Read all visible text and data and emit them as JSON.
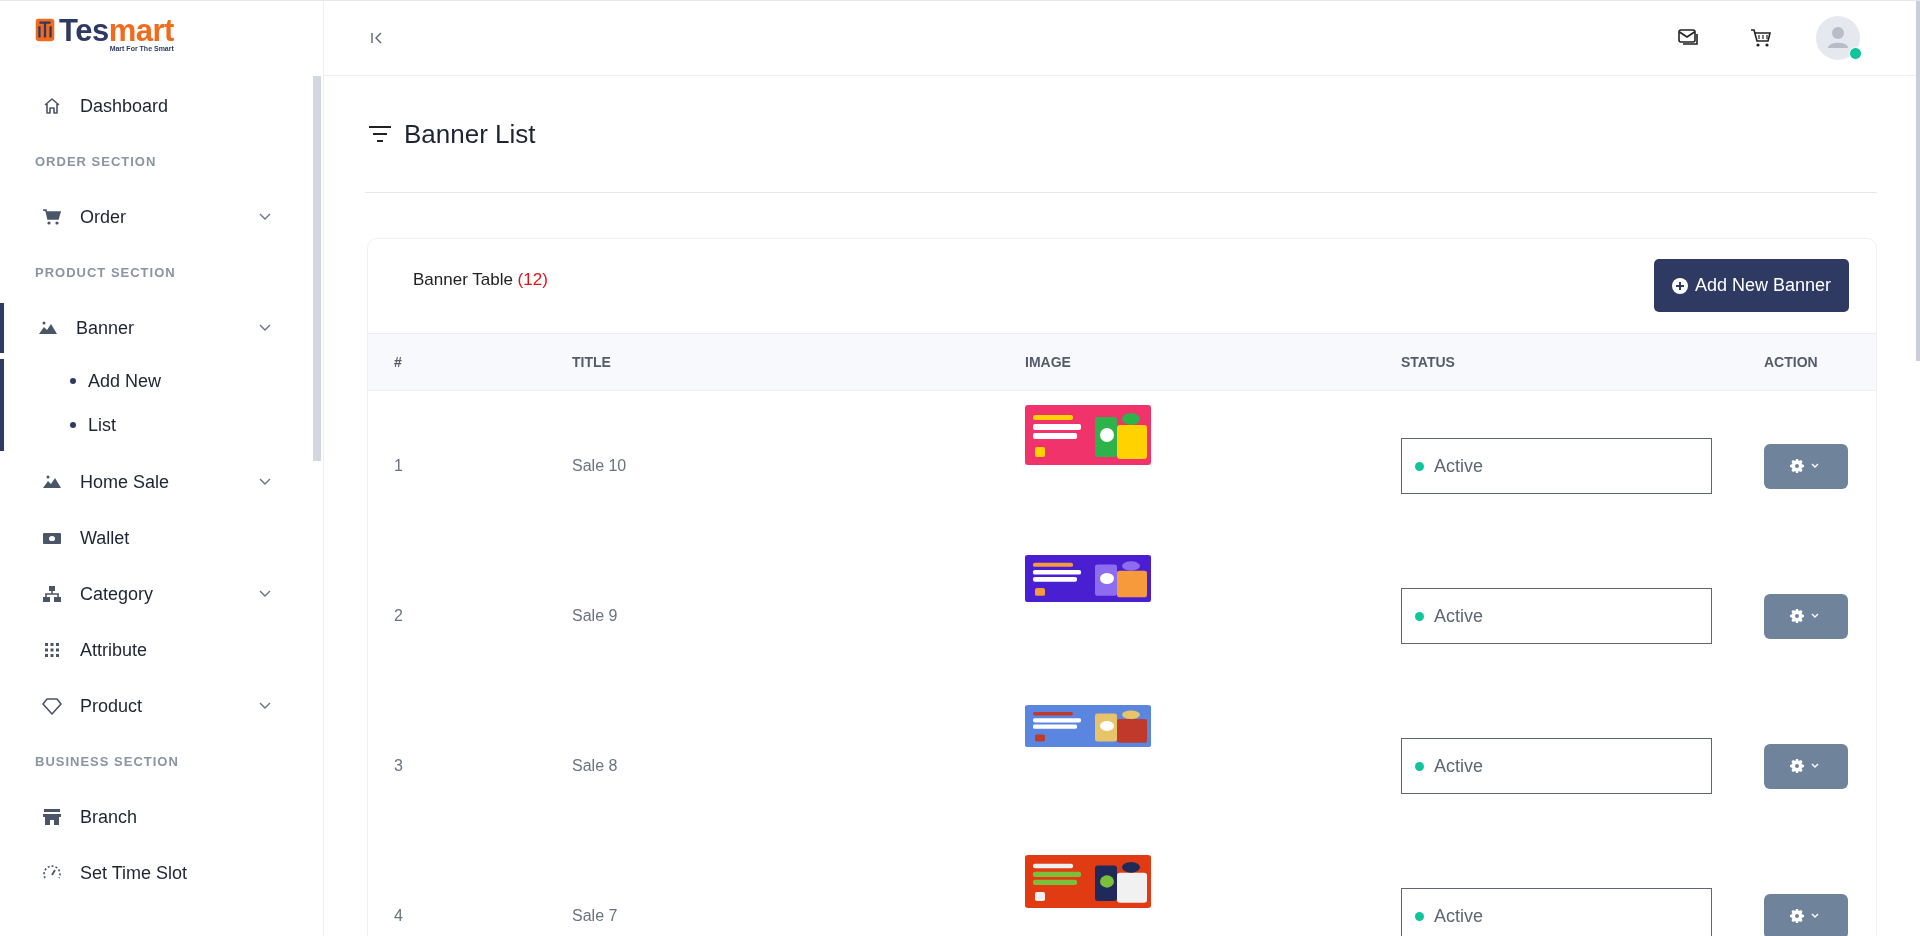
{
  "brand": {
    "name_dark": "Tes",
    "name_accent": "mart",
    "tagline": "Mart For The Smart"
  },
  "sidebar": {
    "items": [
      {
        "kind": "item",
        "label": "Dashboard",
        "selected": false
      },
      {
        "kind": "heading",
        "label": "ORDER SECTION"
      },
      {
        "kind": "group",
        "label": "Order",
        "selected": false
      },
      {
        "kind": "heading",
        "label": "PRODUCT SECTION"
      },
      {
        "kind": "group",
        "label": "Banner",
        "selected": true,
        "children": [
          {
            "label": "Add New",
            "selected": false
          },
          {
            "label": "List",
            "selected": false
          }
        ]
      },
      {
        "kind": "group",
        "label": "Home Sale",
        "selected": false
      },
      {
        "kind": "item",
        "label": "Wallet",
        "selected": false
      },
      {
        "kind": "group",
        "label": "Category",
        "selected": false
      },
      {
        "kind": "item",
        "label": "Attribute",
        "selected": false
      },
      {
        "kind": "group",
        "label": "Product",
        "selected": false
      },
      {
        "kind": "heading",
        "label": "BUSINESS SECTION"
      },
      {
        "kind": "item",
        "label": "Branch",
        "selected": false
      },
      {
        "kind": "item",
        "label": "Set Time Slot",
        "selected": false
      }
    ]
  },
  "header": {
    "online": true
  },
  "page": {
    "title": "Banner List"
  },
  "card": {
    "title": "Banner Table",
    "count": "(12)",
    "add_button": "Add New Banner"
  },
  "table": {
    "columns": [
      "#",
      "TITLE",
      "IMAGE",
      "STATUS",
      "ACTION"
    ],
    "rows": [
      {
        "index": "1",
        "title": "Sale 10",
        "status": "Active",
        "color": "#10c59a"
      },
      {
        "index": "2",
        "title": "Sale 9",
        "status": "Active",
        "color": "#10c59a"
      },
      {
        "index": "3",
        "title": "Sale 8",
        "status": "Active",
        "color": "#10c59a"
      },
      {
        "index": "4",
        "title": "Sale 7",
        "status": "Active",
        "color": "#10c59a"
      }
    ]
  }
}
